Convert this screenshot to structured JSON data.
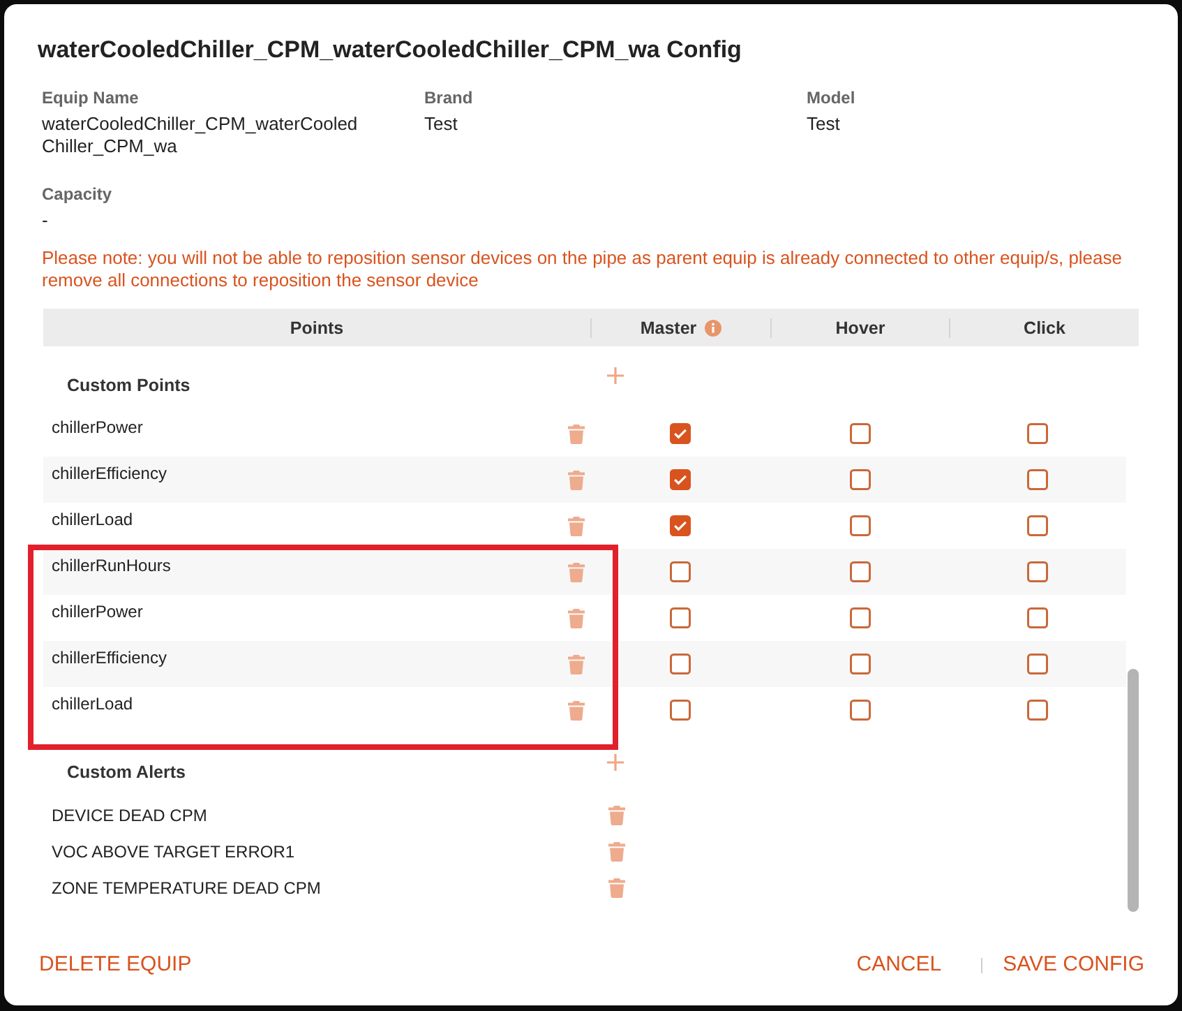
{
  "dialog": {
    "title": "waterCooledChiller_CPM_waterCooledChiller_CPM_wa Config"
  },
  "info": [
    {
      "label": "Equip Name",
      "value": "waterCooledChiller_CPM_waterCooledChiller_CPM_wa"
    },
    {
      "label": "Brand",
      "value": "Test"
    },
    {
      "label": "Model",
      "value": "Test"
    },
    {
      "label": "Capacity",
      "value": "-"
    }
  ],
  "note": "Please note: you will not be able to reposition sensor devices on the pipe as parent equip is already connected to other equip/s, please remove all connections to reposition the sensor device",
  "table": {
    "columns": [
      {
        "label": "Points",
        "info": false
      },
      {
        "label": "Master",
        "info": true
      },
      {
        "label": "Hover",
        "info": false
      },
      {
        "label": "Click",
        "info": false
      }
    ],
    "sections": [
      {
        "kind": "points",
        "title": "Custom Points",
        "rows": [
          {
            "name": "chillerPower",
            "checks": [
              true,
              false,
              false
            ],
            "highlighted": false
          },
          {
            "name": "chillerEfficiency",
            "checks": [
              true,
              false,
              false
            ],
            "highlighted": false
          },
          {
            "name": "chillerLoad",
            "checks": [
              true,
              false,
              false
            ],
            "highlighted": false
          },
          {
            "name": "chillerRunHours",
            "checks": [
              false,
              false,
              false
            ],
            "highlighted": true
          },
          {
            "name": "chillerPower",
            "checks": [
              false,
              false,
              false
            ],
            "highlighted": true
          },
          {
            "name": "chillerEfficiency",
            "checks": [
              false,
              false,
              false
            ],
            "highlighted": true
          },
          {
            "name": "chillerLoad",
            "checks": [
              false,
              false,
              false
            ],
            "highlighted": true
          }
        ]
      },
      {
        "kind": "alerts",
        "title": "Custom Alerts",
        "rows": [
          {
            "name": "DEVICE DEAD CPM"
          },
          {
            "name": "VOC ABOVE TARGET ERROR1"
          },
          {
            "name": "ZONE TEMPERATURE DEAD CPM"
          }
        ]
      }
    ]
  },
  "footer": {
    "delete": "DELETE EQUIP",
    "cancel": "CANCEL",
    "save": "SAVE CONFIG"
  }
}
